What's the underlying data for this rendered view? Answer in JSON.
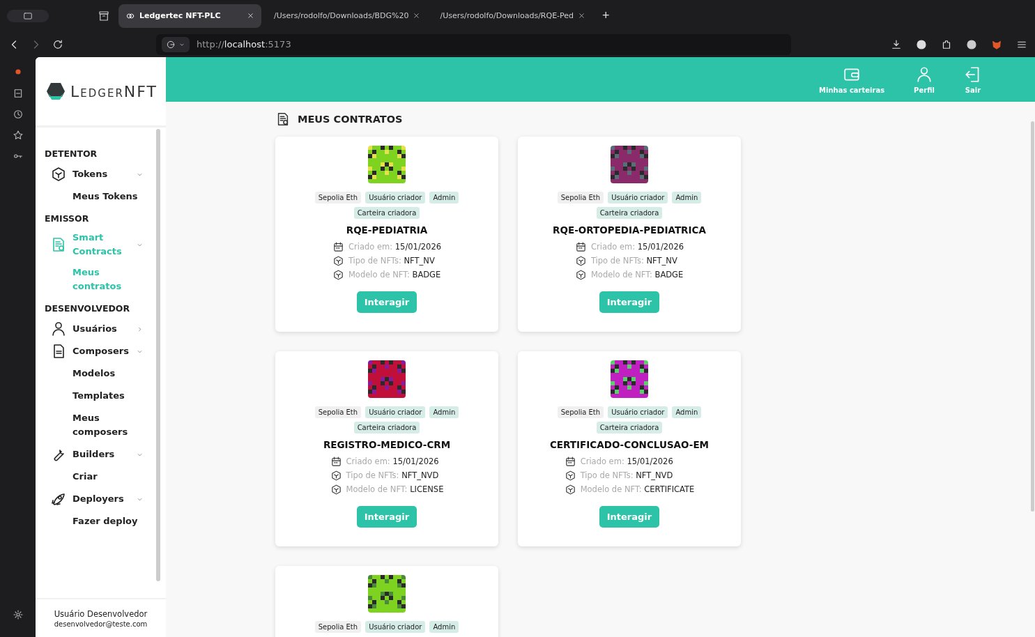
{
  "browser": {
    "tabs": [
      {
        "title": "Ledgertec NFT-PLC",
        "selected": true
      },
      {
        "title": "/Users/rodolfo/Downloads/BDG%20",
        "selected": false
      },
      {
        "title": "/Users/rodolfo/Downloads/RQE-Ped",
        "selected": false
      }
    ],
    "new_tab": "+",
    "url": "http://**localhost**:5173"
  },
  "logo": {
    "text": "LedgerNFT"
  },
  "sidebar": {
    "sections": [
      {
        "title": "DETENTOR",
        "items": [
          {
            "label": "Tokens",
            "expanded": true,
            "selected": false,
            "children": [
              {
                "label": "Meus Tokens",
                "selected": false
              }
            ]
          }
        ]
      },
      {
        "title": "EMISSOR",
        "items": [
          {
            "label": "Smart Contracts",
            "expanded": true,
            "selected": true,
            "children": [
              {
                "label": "Meus contratos",
                "selected": true
              }
            ]
          }
        ]
      },
      {
        "title": "DESENVOLVEDOR",
        "items": [
          {
            "label": "Usuários",
            "expanded": false,
            "selected": false
          },
          {
            "label": "Composers",
            "expanded": true,
            "selected": false,
            "children": [
              {
                "label": "Modelos",
                "selected": false
              },
              {
                "label": "Templates",
                "selected": false
              },
              {
                "label": "Meus composers",
                "selected": false
              }
            ]
          },
          {
            "label": "Builders",
            "expanded": true,
            "selected": false,
            "children": [
              {
                "label": "Criar",
                "selected": false
              }
            ]
          },
          {
            "label": "Deployers",
            "expanded": true,
            "selected": false,
            "children": [
              {
                "label": "Fazer deploy",
                "selected": false
              }
            ]
          }
        ]
      }
    ],
    "user": {
      "name": "Usuário Desenvolvedor",
      "email": "desenvolvedor@teste.com"
    }
  },
  "header": {
    "actions": [
      {
        "label": "Minhas carteiras"
      },
      {
        "label": "Perfil"
      },
      {
        "label": "Sair"
      }
    ]
  },
  "page": {
    "title": "MEUS CONTRATOS",
    "contracts": [
      {
        "name": "RQE-PEDIATRIA",
        "color": "#7ed321",
        "tags": [
          {
            "label": "Sepolia Eth",
            "kind": "network"
          },
          {
            "label": "Usuário criador",
            "kind": "role"
          },
          {
            "label": "Admin",
            "kind": "role"
          },
          {
            "label": "Carteira criadora",
            "kind": "role"
          }
        ],
        "fields": [
          {
            "label": "Criado em:",
            "value": "15/01/2026"
          },
          {
            "label": "Tipo de NFTs:",
            "value": "NFT_NV"
          },
          {
            "label": "Modelo de NFT:",
            "value": "BADGE"
          }
        ],
        "button": "Interagir"
      },
      {
        "name": "RQE-ORTOPEDIA-PEDIATRICA",
        "color": "#8a2a6a",
        "tags": [
          {
            "label": "Sepolia Eth",
            "kind": "network"
          },
          {
            "label": "Usuário criador",
            "kind": "role"
          },
          {
            "label": "Admin",
            "kind": "role"
          },
          {
            "label": "Carteira criadora",
            "kind": "role"
          }
        ],
        "fields": [
          {
            "label": "Criado em:",
            "value": "15/01/2026"
          },
          {
            "label": "Tipo de NFTs:",
            "value": "NFT_NV"
          },
          {
            "label": "Modelo de NFT:",
            "value": "BADGE"
          }
        ],
        "button": "Interagir"
      },
      {
        "name": "REGISTRO-MEDICO-CRM",
        "color": "#c0103a",
        "tags": [
          {
            "label": "Sepolia Eth",
            "kind": "network"
          },
          {
            "label": "Usuário criador",
            "kind": "role"
          },
          {
            "label": "Admin",
            "kind": "role"
          },
          {
            "label": "Carteira criadora",
            "kind": "role"
          }
        ],
        "fields": [
          {
            "label": "Criado em:",
            "value": "15/01/2026"
          },
          {
            "label": "Tipo de NFTs:",
            "value": "NFT_NVD"
          },
          {
            "label": "Modelo de NFT:",
            "value": "LICENSE"
          }
        ],
        "button": "Interagir"
      },
      {
        "name": "CERTIFICADO-CONCLUSAO-EM",
        "color": "#c020c0",
        "tags": [
          {
            "label": "Sepolia Eth",
            "kind": "network"
          },
          {
            "label": "Usuário criador",
            "kind": "role"
          },
          {
            "label": "Admin",
            "kind": "role"
          },
          {
            "label": "Carteira criadora",
            "kind": "role"
          }
        ],
        "fields": [
          {
            "label": "Criado em:",
            "value": "15/01/2026"
          },
          {
            "label": "Tipo de NFTs:",
            "value": "NFT_NVD"
          },
          {
            "label": "Modelo de NFT:",
            "value": "CERTIFICATE"
          }
        ],
        "button": "Interagir"
      },
      {
        "color": "#7ed321",
        "tags": [
          {
            "label": "Sepolia Eth",
            "kind": "network"
          },
          {
            "label": "Usuário criador",
            "kind": "role"
          },
          {
            "label": "Admin",
            "kind": "role"
          }
        ]
      }
    ]
  }
}
